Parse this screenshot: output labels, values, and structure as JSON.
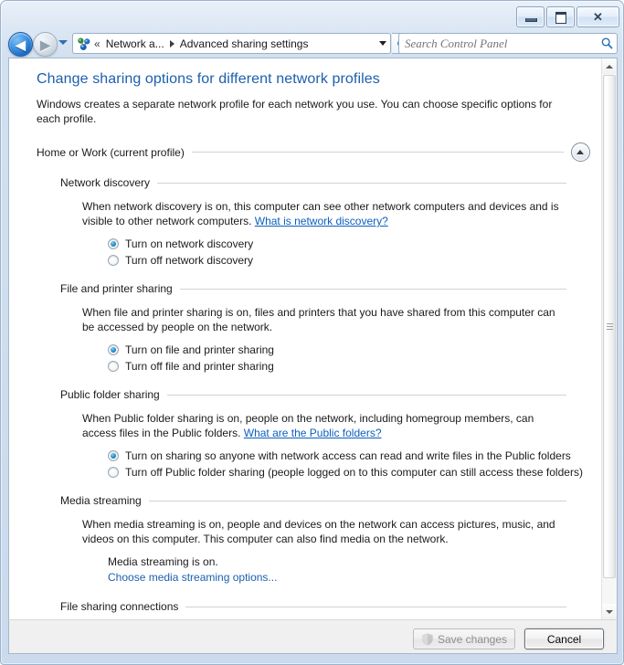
{
  "window": {
    "titlebar_buttons": [
      {
        "name": "minimize",
        "label": "Minimize"
      },
      {
        "name": "restore",
        "label": "Restore"
      },
      {
        "name": "close",
        "label": "Close"
      }
    ],
    "close_glyph": "✕"
  },
  "nav": {
    "back_label": "Back",
    "back_glyph": "◀",
    "forward_label": "Forward",
    "forward_glyph": "▶",
    "recent_pages_label": "Recent pages",
    "refresh_label": "Refresh",
    "address_icon": "network-icon",
    "breadcrumb_overflow": "«",
    "breadcrumbs": [
      {
        "label": "Network a..."
      },
      {
        "label": "Advanced sharing settings"
      }
    ],
    "address_dropdown_label": "Previous locations"
  },
  "search": {
    "placeholder": "Search Control Panel",
    "value": "",
    "icon": "search-icon"
  },
  "main": {
    "title": "Change sharing options for different network profiles",
    "intro": "Windows creates a separate network profile for each network you use. You can choose specific options for each profile.",
    "profile": {
      "label": "Home or Work (current profile)",
      "collapse_label": "Collapse"
    },
    "sections": [
      {
        "id": "network-discovery",
        "title": "Network discovery",
        "desc_before_link": "When network discovery is on, this computer can see other network computers and devices and is visible to other network computers. ",
        "link_text": "What is network discovery?",
        "options": [
          {
            "label": "Turn on network discovery",
            "checked": true
          },
          {
            "label": "Turn off network discovery",
            "checked": false
          }
        ]
      },
      {
        "id": "file-and-printer-sharing",
        "title": "File and printer sharing",
        "desc_before_link": "When file and printer sharing is on, files and printers that you have shared from this computer can be accessed by people on the network.",
        "link_text": "",
        "options": [
          {
            "label": "Turn on file and printer sharing",
            "checked": true
          },
          {
            "label": "Turn off file and printer sharing",
            "checked": false
          }
        ]
      },
      {
        "id": "public-folder-sharing",
        "title": "Public folder sharing",
        "desc_before_link": "When Public folder sharing is on, people on the network, including homegroup members, can access files in the Public folders. ",
        "link_text": "What are the Public folders?",
        "options": [
          {
            "label": "Turn on sharing so anyone with network access can read and write files in the Public folders",
            "checked": true
          },
          {
            "label": "Turn off Public folder sharing (people logged on to this computer can still access these folders)",
            "checked": false
          }
        ]
      }
    ],
    "media_streaming": {
      "id": "media-streaming",
      "title": "Media streaming",
      "desc": "When media streaming is on, people and devices on the network can access pictures, music, and videos on this computer. This computer can also find media on the network.",
      "status": "Media streaming is on.",
      "link_text": "Choose media streaming options..."
    },
    "clipped_next_section": "File sharing connections"
  },
  "scrollbar": {
    "up_label": "Scroll up",
    "down_label": "Scroll down",
    "thumb_label": "Vertical scroll thumb"
  },
  "footer": {
    "save_label": "Save changes",
    "save_enabled": false,
    "save_icon": "uac-shield-icon",
    "cancel_label": "Cancel"
  },
  "colors": {
    "title_blue": "#1c5fad",
    "link_blue": "#0c5fbf",
    "frame_blue": "#c5d6ea",
    "radio_accent": "#2a8fd0"
  }
}
